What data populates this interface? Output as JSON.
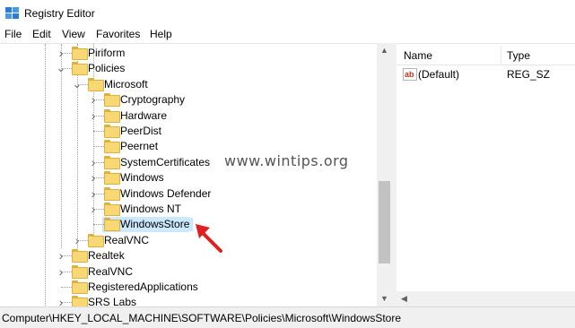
{
  "window": {
    "title": "Registry Editor",
    "icon": "registry-icon"
  },
  "menu": [
    "File",
    "Edit",
    "View",
    "Favorites",
    "Help"
  ],
  "tree": {
    "nodes": [
      {
        "label": "Piriform",
        "expander": "collapsed"
      },
      {
        "label": "Policies",
        "expander": "expanded"
      },
      {
        "label": "Microsoft",
        "expander": "expanded"
      },
      {
        "label": "Cryptography",
        "expander": "collapsed"
      },
      {
        "label": "Hardware",
        "expander": "collapsed"
      },
      {
        "label": "PeerDist",
        "expander": "none"
      },
      {
        "label": "Peernet",
        "expander": "none"
      },
      {
        "label": "SystemCertificates",
        "expander": "collapsed"
      },
      {
        "label": "Windows",
        "expander": "collapsed"
      },
      {
        "label": "Windows Defender",
        "expander": "collapsed"
      },
      {
        "label": "Windows NT",
        "expander": "collapsed"
      },
      {
        "label": "WindowsStore",
        "expander": "none",
        "selected": true
      },
      {
        "label": "RealVNC",
        "expander": "collapsed"
      },
      {
        "label": "Realtek",
        "expander": "collapsed"
      },
      {
        "label": "RealVNC",
        "expander": "collapsed"
      },
      {
        "label": "RegisteredApplications",
        "expander": "none"
      },
      {
        "label": "SRS Labs",
        "expander": "collapsed"
      }
    ]
  },
  "values_list": {
    "columns": [
      "Name",
      "Type"
    ],
    "rows": [
      {
        "icon": "string-value-icon",
        "icon_text": "ab",
        "name": "(Default)",
        "type": "REG_SZ"
      }
    ]
  },
  "watermark": "www.wintips.org",
  "status": {
    "path": "Computer\\HKEY_LOCAL_MACHINE\\SOFTWARE\\Policies\\Microsoft\\WindowsStore"
  },
  "colors": {
    "selection": "#cce8ff",
    "folder": "#f8d775",
    "annotation_arrow": "#e02020"
  }
}
